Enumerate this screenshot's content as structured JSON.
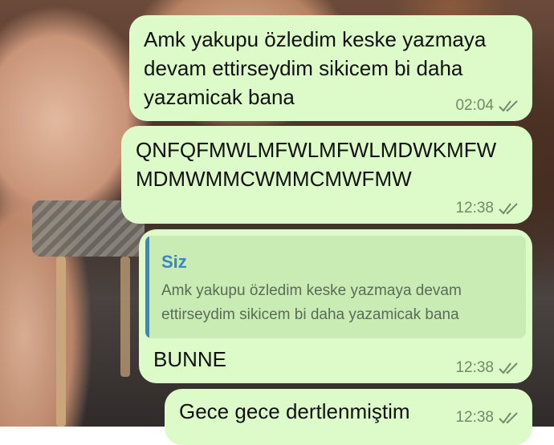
{
  "messages": [
    {
      "text": "Amk yakupu özledim keske yazmaya devam ettirseydim sikicem bi daha yazamicak bana",
      "time": "02:04"
    },
    {
      "text": "QNFQFMWLMFWLMFWLMDWKMFW MDMWMMCWMMCMWFMW",
      "time": "12:38"
    },
    {
      "reply": {
        "sender": "Siz",
        "text": "Amk yakupu özledim keske yazmaya devam ettirseydim sikicem bi daha yazamicak bana"
      },
      "text": "BUNNE",
      "time": "12:38"
    },
    {
      "text": "Gece gece dertlenmiştim",
      "time": "12:38"
    }
  ],
  "colors": {
    "bubble": "#dcfbc8",
    "reply_accent": "#3b87c4",
    "ticks": "#6f8b6a"
  }
}
